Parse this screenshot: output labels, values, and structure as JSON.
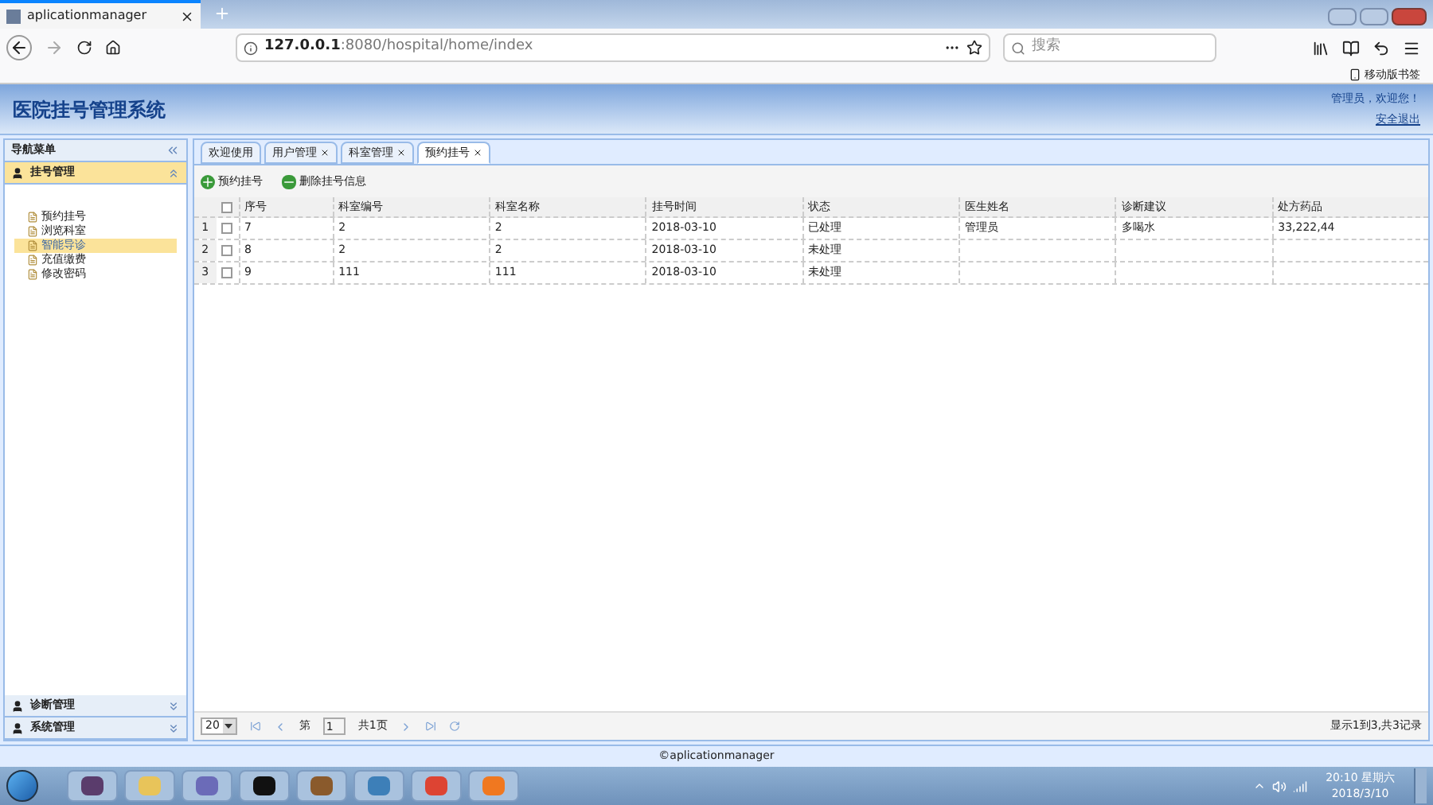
{
  "browser": {
    "tab_title": "aplicationmanager",
    "url_host": "127.0.0.1",
    "url_rest": ":8080/hospital/home/index",
    "search_placeholder": "搜索",
    "bookmark": "移动版书签"
  },
  "header": {
    "title": "医院挂号管理系统",
    "greeting": "管理员，欢迎您！",
    "logout": "安全退出"
  },
  "sidebar": {
    "title": "导航菜单",
    "groups": [
      {
        "label": "挂号管理",
        "expanded": true,
        "items": [
          {
            "label": "预约挂号",
            "selected": false
          },
          {
            "label": "浏览科室",
            "selected": false
          },
          {
            "label": "智能导诊",
            "selected": true
          },
          {
            "label": "充值缴费",
            "selected": false
          },
          {
            "label": "修改密码",
            "selected": false
          }
        ]
      },
      {
        "label": "诊断管理",
        "expanded": false
      },
      {
        "label": "系统管理",
        "expanded": false
      }
    ]
  },
  "tabs": [
    {
      "label": "欢迎使用",
      "closable": false,
      "selected": false
    },
    {
      "label": "用户管理",
      "closable": true,
      "selected": false
    },
    {
      "label": "科室管理",
      "closable": true,
      "selected": false
    },
    {
      "label": "预约挂号",
      "closable": true,
      "selected": true
    }
  ],
  "toolbar": [
    {
      "kind": "add",
      "label": "预约挂号"
    },
    {
      "kind": "remove",
      "label": "删除挂号信息"
    }
  ],
  "table": {
    "select_all_checked": false,
    "columns": [
      "序号",
      "科室编号",
      "科室名称",
      "挂号时间",
      "状态",
      "医生姓名",
      "诊断建议",
      "处方药品"
    ],
    "rows": [
      {
        "index": "1",
        "checked": false,
        "cells": [
          "7",
          "2",
          "2",
          "2018-03-10",
          "已处理",
          "管理员",
          "多喝水",
          "33,222,44"
        ]
      },
      {
        "index": "2",
        "checked": false,
        "cells": [
          "8",
          "2",
          "2",
          "2018-03-10",
          "未处理",
          "",
          "",
          ""
        ]
      },
      {
        "index": "3",
        "checked": false,
        "cells": [
          "9",
          "111",
          "111",
          "2018-03-10",
          "未处理",
          "",
          "",
          ""
        ]
      }
    ]
  },
  "pager": {
    "page_size": "20",
    "page_label": "第",
    "page": "1",
    "total_label": "共1页",
    "summary": "显示1到3,共3记录"
  },
  "footer": "©aplicationmanager",
  "taskbar": {
    "time": "20:10 星期六",
    "date": "2018/3/10"
  }
}
